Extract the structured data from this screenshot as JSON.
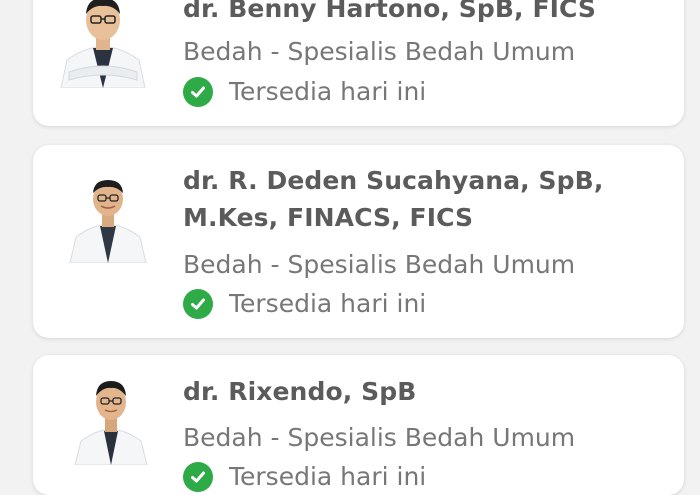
{
  "doctors": [
    {
      "name": "dr. Benny Hartono, SpB, FICS",
      "specialty": "Bedah - Spesialis Bedah Umum",
      "availability": "Tersedia hari ini"
    },
    {
      "name": "dr. R. Deden Sucahyana, SpB, M.Kes, FINACS, FICS",
      "specialty": "Bedah - Spesialis Bedah Umum",
      "availability": "Tersedia hari ini"
    },
    {
      "name": "dr. Rixendo, SpB",
      "specialty": "Bedah - Spesialis Bedah Umum",
      "availability": "Tersedia hari ini"
    }
  ],
  "colors": {
    "check": "#2eaa47",
    "name_text": "#5b5b5b",
    "secondary_text": "#777777",
    "background": "#f2f2f2",
    "card": "#ffffff"
  },
  "icons": {
    "availability": "check-circle-icon",
    "photo": "doctor-photo"
  }
}
